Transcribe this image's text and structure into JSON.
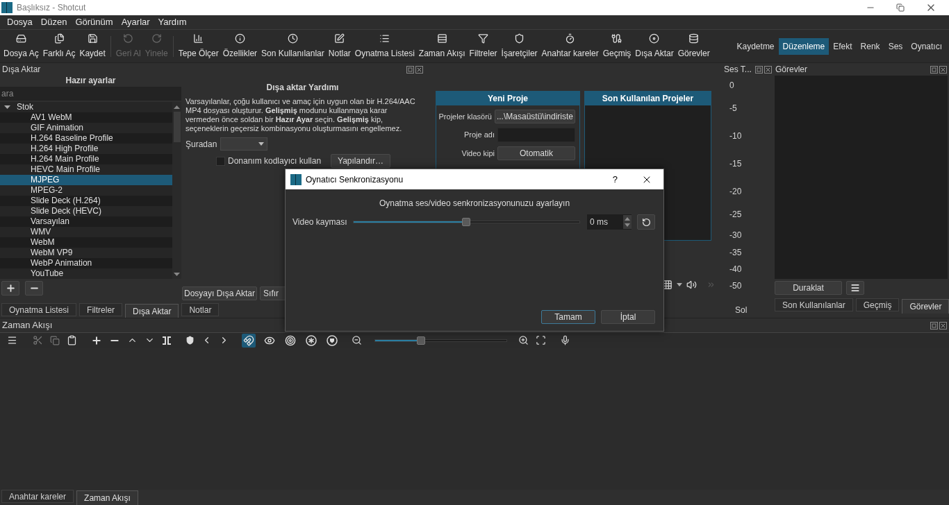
{
  "window": {
    "title": "Başlıksız - Shotcut"
  },
  "menu": [
    "Dosya",
    "Düzen",
    "Görünüm",
    "Ayarlar",
    "Yardım"
  ],
  "toolbar": [
    {
      "kind": "open",
      "label": "Dosya Aç",
      "disabled": false
    },
    {
      "kind": "open_other",
      "label": "Farklı Aç",
      "disabled": false
    },
    {
      "kind": "save",
      "label": "Kaydet",
      "disabled": false
    },
    {
      "kind": "undo",
      "label": "Geri Al",
      "disabled": true
    },
    {
      "kind": "redo",
      "label": "Yinele",
      "disabled": true
    },
    {
      "kind": "meter",
      "label": "Tepe Ölçer",
      "disabled": false
    },
    {
      "kind": "properties",
      "label": "Özellikler",
      "disabled": false
    },
    {
      "kind": "recent",
      "label": "Son Kullanılanlar",
      "disabled": false
    },
    {
      "kind": "notes",
      "label": "Notlar",
      "disabled": false
    },
    {
      "kind": "playlist",
      "label": "Oynatma Listesi",
      "disabled": false
    },
    {
      "kind": "timeline",
      "label": "Zaman Akışı",
      "disabled": false
    },
    {
      "kind": "filters",
      "label": "Filtreler",
      "disabled": false
    },
    {
      "kind": "markers",
      "label": "İşaretçiler",
      "disabled": false
    },
    {
      "kind": "keyframes",
      "label": "Anahtar kareler",
      "disabled": false
    },
    {
      "kind": "history",
      "label": "Geçmiş",
      "disabled": false
    },
    {
      "kind": "export",
      "label": "Dışa Aktar",
      "disabled": false
    },
    {
      "kind": "jobs",
      "label": "Görevler",
      "disabled": false
    }
  ],
  "layouts": [
    {
      "label": "Kaydetme",
      "selected": false
    },
    {
      "label": "Düzenleme",
      "selected": true
    },
    {
      "label": "Efekt",
      "selected": false
    },
    {
      "label": "Renk",
      "selected": false
    },
    {
      "label": "Ses",
      "selected": false
    },
    {
      "label": "Oynatıcı",
      "selected": false
    }
  ],
  "export_panel": {
    "title": "Dışa Aktar",
    "presets_heading": "Hazır ayarlar",
    "search": {
      "placeholder": "ara"
    },
    "tree": [
      {
        "label": "Stok",
        "expanded": true,
        "selected": false,
        "children": [
          {
            "label": "AV1 WebM",
            "selected": false
          },
          {
            "label": "GIF Animation",
            "selected": false
          },
          {
            "label": "H.264 Baseline Profile",
            "selected": false
          },
          {
            "label": "H.264 High Profile",
            "selected": false
          },
          {
            "label": "H.264 Main Profile",
            "selected": false
          },
          {
            "label": "HEVC Main Profile",
            "selected": false
          },
          {
            "label": "MJPEG",
            "selected": true
          },
          {
            "label": "MPEG-2",
            "selected": false
          },
          {
            "label": "Slide Deck (H.264)",
            "selected": false
          },
          {
            "label": "Slide Deck (HEVC)",
            "selected": false
          },
          {
            "label": "Varsayılan",
            "selected": false
          },
          {
            "label": "WMV",
            "selected": false
          },
          {
            "label": "WebM",
            "selected": false
          },
          {
            "label": "WebM VP9",
            "selected": false
          },
          {
            "label": "WebP Animation",
            "selected": false
          },
          {
            "label": "YouTube",
            "selected": false
          }
        ]
      }
    ],
    "help_heading": "Dışa aktar Yardımı",
    "help_text": "Varsayılanlar, çoğu kullanıcı ve amaç için uygun olan bir H.264/AAC MP4 dosyası oluşturur. **Gelişmiş** modunu kullanmaya karar vermeden önce soldan bir **Hazır Ayar** seçin. **Gelişmiş** kip, seçeneklerin geçersiz kombinasyonu oluşturmasını engellemez.",
    "from_label": "Şuradan",
    "hardware_encoder": {
      "label": "Donanım kodlayıcı kullan",
      "checked": false
    },
    "configure_button": "Yapılandır…",
    "export_button": "Dosyayı Dışa Aktar",
    "reset_button": "Sıfır"
  },
  "left_tabs": [
    {
      "label": "Oynatma Listesi",
      "selected": false
    },
    {
      "label": "Filtreler",
      "selected": false
    },
    {
      "label": "Dışa Aktar",
      "selected": true
    },
    {
      "label": "Notlar",
      "selected": false
    }
  ],
  "player": {
    "new_project": {
      "title": "Yeni Proje",
      "fields": [
        {
          "label": "Projeler klasörü",
          "kind": "button",
          "value": "...\\Masaüstü\\indiriste"
        },
        {
          "label": "Proje adı",
          "kind": "input"
        },
        {
          "label": "Video kipi",
          "kind": "button",
          "value": "Otomatik"
        }
      ]
    },
    "recent_projects": {
      "title": "Son Kullanılan Projeler"
    }
  },
  "audio_meter": {
    "title": "Ses T...",
    "scale": [
      "0",
      "-5",
      "-10",
      "-15",
      "-20",
      "-25",
      "-30",
      "-35",
      "-40",
      "-50"
    ],
    "channel": "Sol"
  },
  "jobs": {
    "title": "Görevler",
    "pause_button": "Duraklat"
  },
  "right_tabs": [
    {
      "label": "Son Kullanılanlar",
      "selected": false
    },
    {
      "label": "Geçmiş",
      "selected": false
    },
    {
      "label": "Görevler",
      "selected": true
    }
  ],
  "timeline": {
    "title": "Zaman Akışı",
    "toggles": [
      {
        "kind": "snap",
        "on": true
      },
      {
        "kind": "scrub",
        "on": false
      },
      {
        "kind": "ripple",
        "on": false
      },
      {
        "kind": "ripple_all",
        "on": false
      },
      {
        "kind": "ripple_markers",
        "on": false
      }
    ],
    "zoom": {
      "level": 0.35
    }
  },
  "bottom_tabs": [
    {
      "label": "Anahtar kareler",
      "selected": false
    },
    {
      "label": "Zaman Akışı",
      "selected": true
    }
  ],
  "dialog": {
    "title": "Oynatıcı Senkronizasyonu",
    "help_glyph": "?",
    "message": "Oynatma ses/video senkronizasyonunuzu ayarlayın",
    "offset_label": "Video kayması",
    "offset": {
      "level": 0.5
    },
    "offset_value": "0 ms",
    "buttons": [
      {
        "label": "Tamam",
        "default": true
      },
      {
        "label": "İptal",
        "default": false
      }
    ]
  }
}
